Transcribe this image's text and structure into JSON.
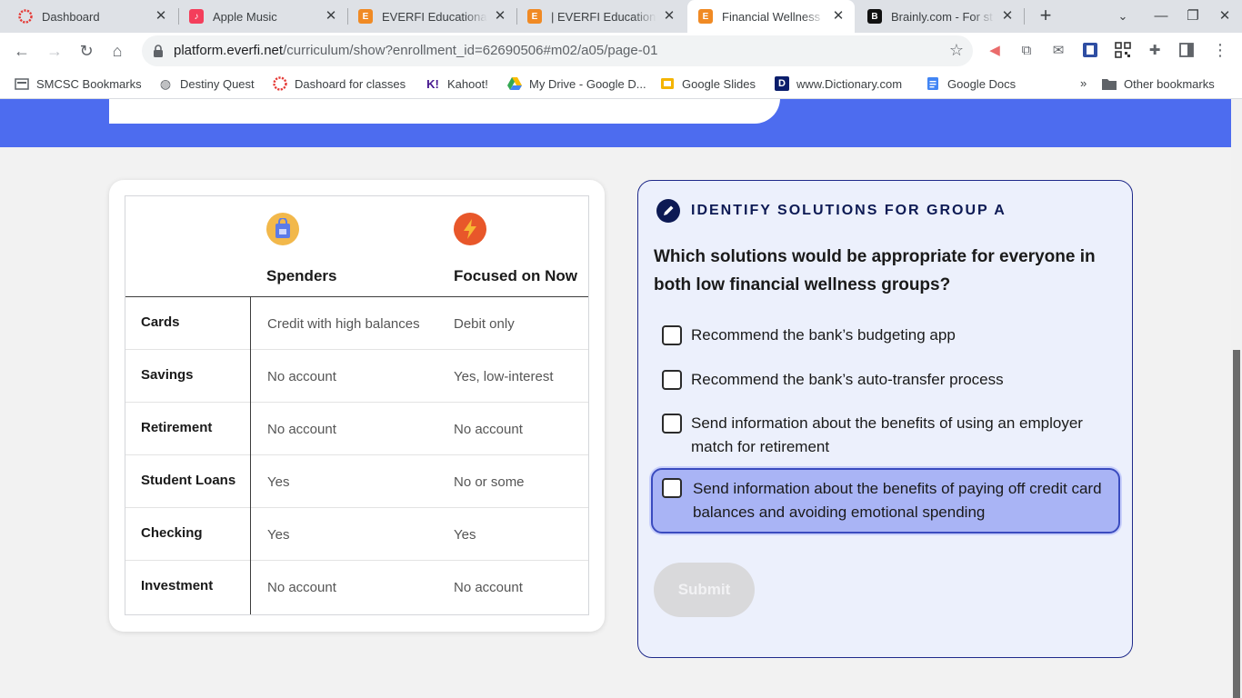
{
  "browser": {
    "tabs": [
      {
        "title": "Dashboard",
        "icon": "dashboard-ring-icon",
        "active": false
      },
      {
        "title": "Apple Music",
        "icon": "apple-music-icon",
        "active": false
      },
      {
        "title": "EVERFI Educational",
        "icon": "everfi-icon",
        "active": false
      },
      {
        "title": "| EVERFI Education",
        "icon": "everfi-icon",
        "active": false
      },
      {
        "title": "Financial Wellness",
        "icon": "everfi-icon",
        "active": true
      },
      {
        "title": "Brainly.com - For st",
        "icon": "brainly-icon",
        "active": false
      }
    ],
    "url_host": "platform.everfi.net",
    "url_path": "/curriculum/show?enrollment_id=62690506#m02/a05/page-01",
    "bookmarks": [
      {
        "label": "SMCSC Bookmarks",
        "icon": "bookmark-folder-icon"
      },
      {
        "label": "Destiny Quest",
        "icon": "globe-icon"
      },
      {
        "label": "Dashoard for classes",
        "icon": "dashboard-ring-icon"
      },
      {
        "label": "Kahoot!",
        "icon": "kahoot-icon"
      },
      {
        "label": "My Drive - Google D...",
        "icon": "google-drive-icon"
      },
      {
        "label": "Google Slides",
        "icon": "google-slides-icon"
      },
      {
        "label": "www.Dictionary.com",
        "icon": "dictionary-icon"
      },
      {
        "label": "Google Docs",
        "icon": "google-docs-icon"
      }
    ],
    "bookmarks_overflow": "»",
    "other_bookmarks": "Other bookmarks"
  },
  "table": {
    "groups": [
      {
        "label": "Spenders",
        "icon": "shopping-bag-icon",
        "color": "#f2b84b"
      },
      {
        "label": "Focused on Now",
        "icon": "lightning-icon",
        "color": "#e8572a"
      }
    ],
    "rows": [
      {
        "label": "Cards",
        "spenders": "Credit with high balances",
        "focused": "Debit only"
      },
      {
        "label": "Savings",
        "spenders": "No account",
        "focused": "Yes, low-interest"
      },
      {
        "label": "Retirement",
        "spenders": "No account",
        "focused": "No account"
      },
      {
        "label": "Student Loans",
        "spenders": "Yes",
        "focused": "No or some"
      },
      {
        "label": "Checking",
        "spenders": "Yes",
        "focused": "Yes"
      },
      {
        "label": "Investment",
        "spenders": "No account",
        "focused": "No account"
      }
    ]
  },
  "question": {
    "heading": "IDENTIFY SOLUTIONS FOR GROUP A",
    "prompt": "Which solutions would be appropriate for everyone in both low financial wellness groups?",
    "options": [
      {
        "label": "Recommend the bank’s budgeting app",
        "checked": false
      },
      {
        "label": "Recommend the bank’s auto-transfer process",
        "checked": false
      },
      {
        "label": "Send information about the benefits of using an employer match for retirement",
        "checked": false
      },
      {
        "label": "Send information about the benefits of paying off credit card balances and avoiding emotional spending",
        "checked": false,
        "focused": true
      }
    ],
    "submit_label": "Submit"
  },
  "colors": {
    "hero_blue": "#4d6cef",
    "card_border": "#1f2a8a",
    "focus_fill": "#a9b4f5"
  }
}
